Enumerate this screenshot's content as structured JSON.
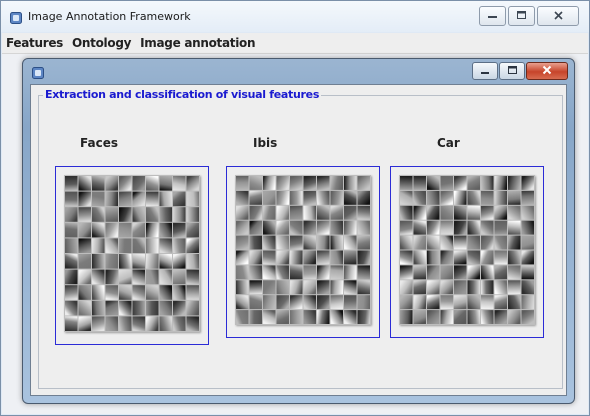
{
  "window": {
    "title": "Image Annotation Framework",
    "caption_buttons": [
      "minimize",
      "maximize",
      "close"
    ]
  },
  "menu": {
    "items": [
      "Features",
      "Ontology",
      "Image annotation"
    ]
  },
  "inner_window": {
    "caption_buttons": [
      "minimize",
      "maximize",
      "close"
    ]
  },
  "panel": {
    "legend": "Extraction and classification of visual features",
    "legend_color": "#1a1ad0",
    "categories": [
      {
        "label": "Faces",
        "seed": 11
      },
      {
        "label": "Ibis",
        "seed": 27
      },
      {
        "label": "Car",
        "seed": 53
      }
    ]
  },
  "colors": {
    "accent_border": "#2b2bd6",
    "close_button": "#c7442a"
  }
}
